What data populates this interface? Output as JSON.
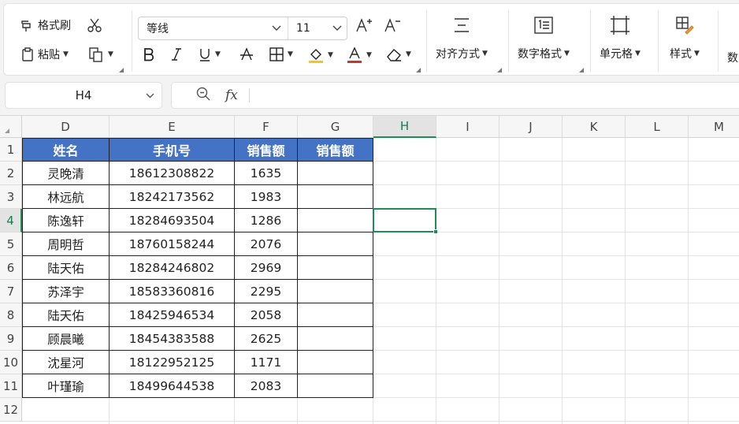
{
  "ribbon": {
    "format_painter": "格式刷",
    "paste": "粘贴",
    "font_name": "等线",
    "font_size": "11",
    "align": "对齐方式",
    "number_format": "数字格式",
    "cell": "单元格",
    "style": "样式",
    "truncated": "数"
  },
  "formula_bar": {
    "name_box": "H4",
    "fx": "fx",
    "value": ""
  },
  "columns": [
    "D",
    "E",
    "F",
    "G",
    "H",
    "I",
    "J",
    "K",
    "L",
    "M"
  ],
  "rows": [
    "1",
    "2",
    "3",
    "4",
    "5",
    "6",
    "7",
    "8",
    "9",
    "10",
    "11",
    "12"
  ],
  "selected_cell": {
    "col": "H",
    "row": "4"
  },
  "colors": {
    "header_fill": "#4472c4",
    "selection": "#1f8b55"
  },
  "table": {
    "headers": [
      "姓名",
      "手机号",
      "销售额",
      "销售额"
    ],
    "rows": [
      [
        "灵晚清",
        "18612308822",
        "1635",
        ""
      ],
      [
        "林远航",
        "18242173562",
        "1983",
        ""
      ],
      [
        "陈逸轩",
        "18284693504",
        "1286",
        ""
      ],
      [
        "周明哲",
        "18760158244",
        "2076",
        ""
      ],
      [
        "陆天佑",
        "18284246802",
        "2969",
        ""
      ],
      [
        "苏泽宇",
        "18583360816",
        "2295",
        ""
      ],
      [
        "陆天佑",
        "18425946534",
        "2058",
        ""
      ],
      [
        "顾晨曦",
        "18454383588",
        "2625",
        ""
      ],
      [
        "沈星河",
        "18122952125",
        "1171",
        ""
      ],
      [
        "叶瑾瑜",
        "18499644538",
        "2083",
        ""
      ]
    ]
  }
}
